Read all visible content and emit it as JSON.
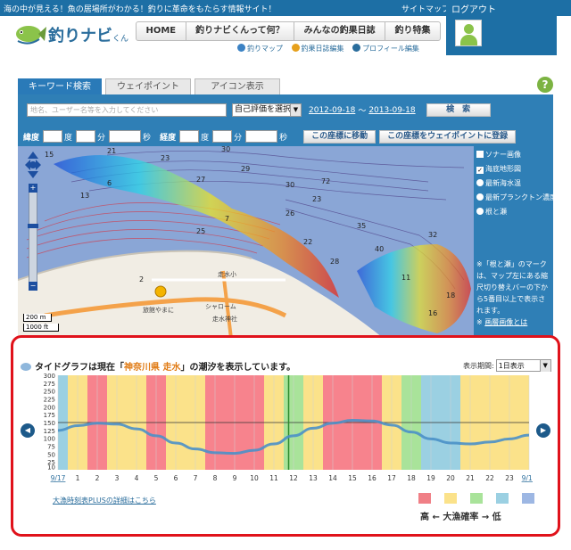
{
  "header": {
    "tagline": "海の中が見える！魚の居場所がわかる！釣りに革命をもたらす情報サイト！",
    "sitemap": "サイトマップ",
    "logout": "ログアウト",
    "logo_text": "釣りナビ",
    "logo_suffix": "くん"
  },
  "nav": {
    "items": [
      "HOME",
      "釣りナビくんって何？",
      "みんなの釣果日誌",
      "釣り特集"
    ]
  },
  "subnav": {
    "items": [
      "釣りマップ",
      "釣果日誌編集",
      "プロフィール編集"
    ]
  },
  "tabs": [
    "キーワード検索",
    "ウェイポイント",
    "アイコン表示"
  ],
  "search": {
    "placeholder": "地名、ユーザー名等を入力してください",
    "rating_select": "自己評価を選択",
    "date_from": "2012-09-18",
    "date_sep": "〜",
    "date_to": "2013-09-18",
    "search_button": "検　索"
  },
  "coords": {
    "lat_label": "緯度",
    "lon_label": "経度",
    "deg": "度",
    "min": "分",
    "sec": "秒",
    "move_button": "この座標に移動",
    "register_button": "この座標をウェイポイントに登録"
  },
  "map": {
    "scale_m": "200 m",
    "scale_ft": "1000 ft",
    "labels": {
      "school": "旅館やまに",
      "shop": "シャローム",
      "shrine": "走水神社",
      "road": "走水小"
    },
    "depth_numbers": [
      "15",
      "21",
      "2",
      "23",
      "30",
      "27",
      "29",
      "30",
      "23",
      "35",
      "32",
      "13",
      "6",
      "26",
      "7",
      "72",
      "25",
      "22",
      "28",
      "40",
      "26",
      "11",
      "4",
      "12",
      "8",
      "10",
      "5",
      "8",
      "39",
      "40",
      "18",
      "16",
      "12",
      "25",
      "17"
    ],
    "layers": [
      {
        "type": "checkbox",
        "checked": false,
        "label": "ソナー画像"
      },
      {
        "type": "checkbox",
        "checked": true,
        "label": "海底地形図"
      },
      {
        "type": "radio",
        "checked": false,
        "label": "最新海水温"
      },
      {
        "type": "radio",
        "checked": false,
        "label": "最新プランクトン濃度"
      },
      {
        "type": "radio",
        "checked": false,
        "label": "根と瀬"
      }
    ],
    "note": "※「根と瀬」のマークは、マップ左にある縮尺切り替えバーの下から5番目以上で表示されます。",
    "note_link": "画層画像とは"
  },
  "tide": {
    "title_prefix": "タイドグラフは現在「",
    "location": "神奈川県 走水",
    "title_suffix": "」の潮汐を表示しています。",
    "period_label": "表示期間:",
    "period_value": "1日表示",
    "link": "大漁時刻表PLUSの詳細はこちら",
    "legend_text": "高 ← 大漁確率 → 低"
  },
  "chart_data": {
    "type": "area",
    "ylim": [
      0,
      300
    ],
    "yticks": [
      300,
      275,
      250,
      225,
      200,
      175,
      150,
      125,
      100,
      75,
      50,
      25,
      10
    ],
    "xticks": [
      "9/17",
      "1",
      "2",
      "3",
      "4",
      "5",
      "6",
      "7",
      "8",
      "9",
      "10",
      "11",
      "12",
      "13",
      "14",
      "15",
      "16",
      "17",
      "18",
      "19",
      "20",
      "21",
      "22",
      "23",
      "9/18"
    ],
    "tide_series": {
      "hours": [
        0,
        1,
        2,
        3,
        4,
        5,
        6,
        7,
        8,
        9,
        10,
        11,
        12,
        13,
        14,
        15,
        16,
        17,
        18,
        19,
        20,
        21,
        22,
        23,
        24
      ],
      "levels": [
        125,
        140,
        148,
        145,
        130,
        108,
        85,
        66,
        54,
        52,
        62,
        82,
        108,
        132,
        148,
        157,
        155,
        142,
        120,
        98,
        85,
        82,
        88,
        98,
        110
      ]
    },
    "current_hour": 11.75,
    "bands": [
      {
        "from": 0,
        "to": 0.5,
        "level": 4
      },
      {
        "from": 0.5,
        "to": 1.5,
        "level": 2
      },
      {
        "from": 1.5,
        "to": 2.5,
        "level": 1
      },
      {
        "from": 2.5,
        "to": 4.5,
        "level": 2
      },
      {
        "from": 4.5,
        "to": 5.5,
        "level": 1
      },
      {
        "from": 5.5,
        "to": 7.5,
        "level": 2
      },
      {
        "from": 7.5,
        "to": 10.5,
        "level": 1
      },
      {
        "from": 10.5,
        "to": 11.5,
        "level": 2
      },
      {
        "from": 11.5,
        "to": 12.5,
        "level": 3
      },
      {
        "from": 12.5,
        "to": 13.5,
        "level": 2
      },
      {
        "from": 13.5,
        "to": 16.5,
        "level": 1
      },
      {
        "from": 16.5,
        "to": 17.5,
        "level": 2
      },
      {
        "from": 17.5,
        "to": 18.5,
        "level": 3
      },
      {
        "from": 18.5,
        "to": 20.5,
        "level": 4
      },
      {
        "from": 20.5,
        "to": 24,
        "level": 2
      }
    ],
    "level_colors": {
      "1": "#f7838d",
      "2": "#fbe28a",
      "3": "#a9e39a",
      "4": "#9bd0e2",
      "5": "#9db7e3"
    },
    "legend_colors": [
      "#f07f86",
      "#fbe28a",
      "#a9e39a",
      "#9bd0e2",
      "#9db7e3"
    ]
  }
}
